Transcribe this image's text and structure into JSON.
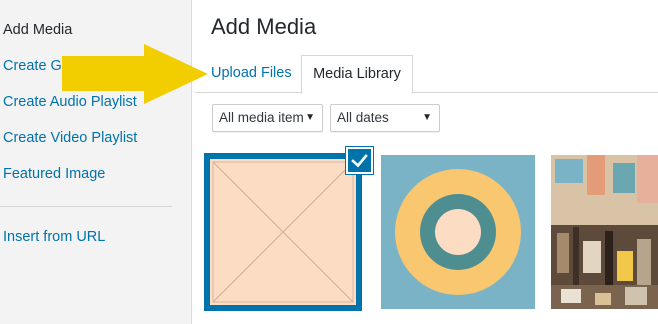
{
  "sidebar": {
    "items": [
      {
        "label": "Add Media"
      },
      {
        "label": "Create Gallery"
      },
      {
        "label": "Create Audio Playlist"
      },
      {
        "label": "Create Video Playlist"
      },
      {
        "label": "Featured Image"
      },
      {
        "label": "Insert from URL"
      }
    ]
  },
  "main": {
    "title": "Add Media",
    "tabs": [
      {
        "label": "Upload Files"
      },
      {
        "label": "Media Library"
      }
    ],
    "filters": {
      "media_type": "All media item",
      "dates": "All dates"
    }
  },
  "colors": {
    "link": "#0073aa",
    "selected_border": "#0073aa",
    "highlight_arrow": "#f2cd00",
    "placeholder_thumb": "#fddcc4",
    "donut_bg": "#7bb3c6",
    "donut_outer": "#f8c770",
    "donut_ring": "#4f8e90"
  },
  "icons": [
    "check-icon",
    "dropdown-caret-icon",
    "pointer-arrow-icon"
  ]
}
